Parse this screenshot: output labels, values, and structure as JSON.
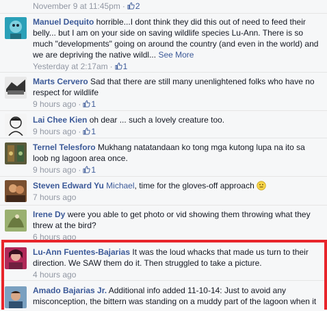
{
  "comments": [
    {
      "author": "",
      "text": "",
      "time": "November 9 at 11:45pm",
      "likes": "2"
    },
    {
      "author": "Manuel Dequito",
      "text": " horrible...I dont think they did this out of need to feed their belly... but I am on your side on saving wildlife species Lu-Ann. There is so much \"developments\" going on around the country (and even in the world) and we are depriving the native wildl...",
      "see_more": "See More",
      "time": "Yesterday at 2:17am",
      "likes": "1"
    },
    {
      "author": "Marts Cervero",
      "text": " Sad that there are still many unenlightened folks who have no respect for wildlife",
      "time": "9 hours ago",
      "likes": "1"
    },
    {
      "author": "Lai Chee Kien",
      "text": " oh dear ... such a lovely creature too.",
      "time": "9 hours ago",
      "likes": "1"
    },
    {
      "author": "Ternel Telesforo",
      "text": " Mukhang natatandaan ko tong mga kutong lupa na ito sa loob ng lagoon area once.",
      "time": "9 hours ago",
      "likes": "1"
    },
    {
      "author": "Steven Edward Yu",
      "mention": "Michael",
      "text": ", time for the gloves-off approach",
      "time": "7 hours ago"
    },
    {
      "author": "Irene Dy",
      "text": " were you able to get photo or vid showing them throwing what they threw at the bird?",
      "time": "6 hours ago"
    },
    {
      "author": "Lu-Ann Fuentes-Bajarias",
      "text": " It was the loud whacks that made us turn to their direction. We SAW them do it. Then struggled to take a picture.",
      "time": "4 hours ago"
    },
    {
      "author": "Amado Bajarias Jr.",
      "text": " Additional info added 11-10-14: Just to avoid any misconception, the bittern was standing on a muddy part of the lagoon when it"
    }
  ],
  "colors": {
    "link": "#3b5998",
    "meta": "#9197a3",
    "highlight": "#e8252b",
    "background": "#f6f7f8"
  },
  "icons": {
    "like": "thumbs-up-icon",
    "emoticon": "smiley-icon"
  }
}
